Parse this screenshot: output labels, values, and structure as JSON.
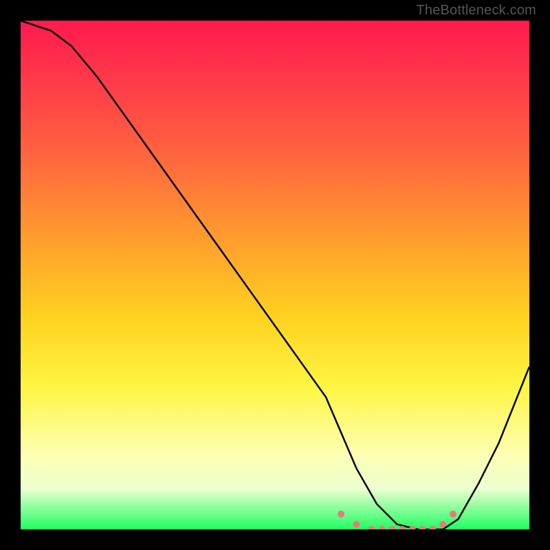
{
  "watermark": "TheBottleneck.com",
  "colors": {
    "background": "#000000",
    "curve": "#000000",
    "dots": "#e77a7a",
    "gradient_stops": [
      "#ff1a4d",
      "#ff3a4a",
      "#ff6a3d",
      "#ff9a2f",
      "#ffd11f",
      "#fff542",
      "#feffb0",
      "#ecffd0",
      "#1fff62"
    ]
  },
  "chart_data": {
    "type": "line",
    "title": "",
    "xlabel": "",
    "ylabel": "",
    "xlim": [
      0,
      100
    ],
    "ylim": [
      0,
      100
    ],
    "x": [
      0,
      6,
      10,
      15,
      20,
      25,
      30,
      35,
      40,
      45,
      50,
      55,
      60,
      63,
      66,
      70,
      74,
      78,
      80,
      83,
      86,
      90,
      94,
      100
    ],
    "values": [
      100,
      98,
      95,
      89,
      82,
      75,
      68,
      61,
      54,
      47,
      40,
      33,
      26,
      19,
      12,
      5,
      1,
      0,
      0,
      0,
      2,
      9,
      17,
      32
    ],
    "highlight_x": [
      63,
      66,
      69,
      71,
      73,
      75,
      77,
      79,
      81,
      83,
      85
    ],
    "highlight_values": [
      3,
      1,
      0,
      0,
      0,
      0,
      0,
      0,
      0,
      1,
      3
    ]
  }
}
